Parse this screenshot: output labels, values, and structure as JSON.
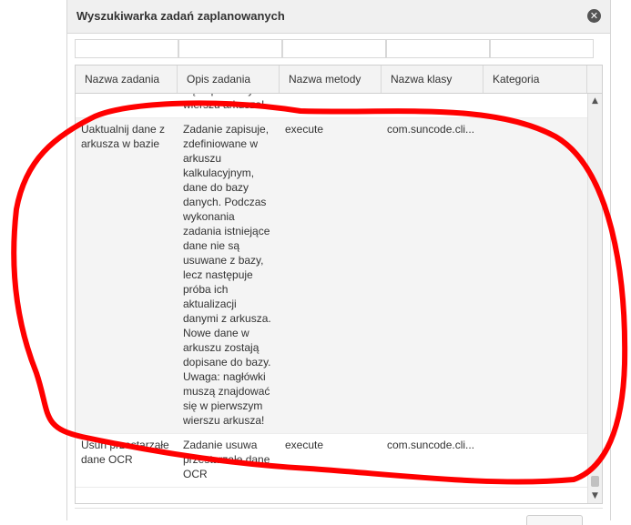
{
  "dialog": {
    "title": "Wyszukiwarka zadań zaplanowanych",
    "close_icon": "close-icon"
  },
  "filters": [
    {
      "value": "",
      "placeholder": ""
    },
    {
      "value": "",
      "placeholder": ""
    },
    {
      "value": "",
      "placeholder": ""
    },
    {
      "value": "",
      "placeholder": ""
    },
    {
      "value": "",
      "placeholder": ""
    }
  ],
  "grid": {
    "columns": [
      "Nazwa zadania",
      "Opis zadania",
      "Nazwa metody",
      "Nazwa klasy",
      "Kategoria"
    ],
    "rows": [
      {
        "name": "",
        "description": "muszą znajdować się w pierwszym wierszu arkusza!",
        "method": "",
        "class": "",
        "category": ""
      },
      {
        "name": "Uaktualnij dane z arkusza w bazie",
        "description": "Zadanie zapisuje, zdefiniowane w arkuszu kalkulacyjnym, dane do bazy danych. Podczas wykonania zadania istniejące dane nie są usuwane z bazy, lecz następuje próba ich aktualizacji danymi z arkusza. Nowe dane w arkuszu zostają dopisane do bazy. Uwaga: nagłówki muszą znajdować się w pierwszym wierszu arkusza!",
        "method": "execute",
        "class": "com.suncode.cli...",
        "category": ""
      },
      {
        "name": "Usuń przestarzałe dane OCR",
        "description": "Zadanie usuwa przestarzałe dane OCR",
        "method": "execute",
        "class": "com.suncode.cli...",
        "category": ""
      }
    ]
  },
  "scrollbar": {
    "up_icon": "▲",
    "down_icon": "▼"
  },
  "colors": {
    "annotation": "#ff0000",
    "header_bg": "#f3f3f3",
    "alt_row_bg": "#f4f4f4"
  }
}
